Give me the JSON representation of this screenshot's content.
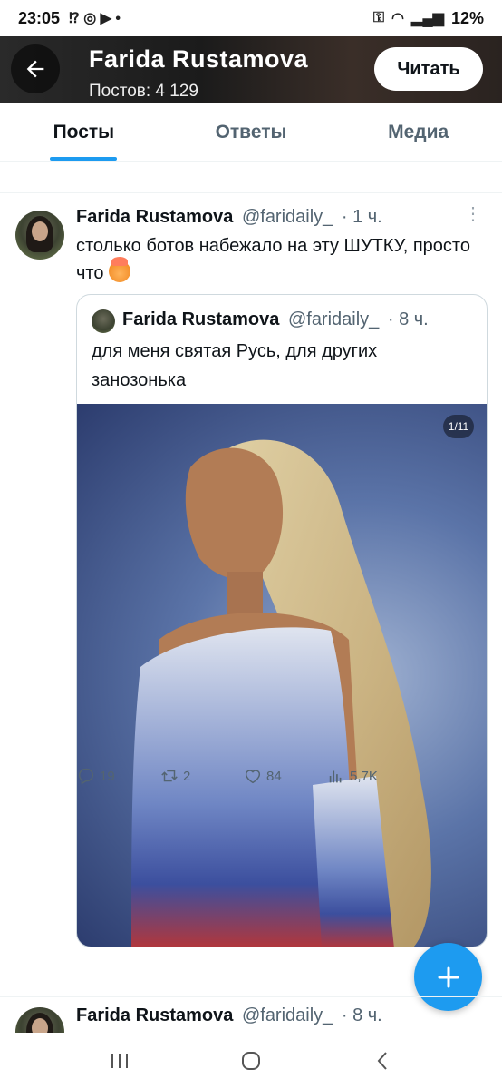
{
  "status_bar": {
    "time": "23:05",
    "battery": "12%"
  },
  "header": {
    "name": "Farida Rustamova",
    "post_count": "Постов: 4 129",
    "read_button": "Читать"
  },
  "tabs": [
    {
      "label": "Посты",
      "active": true
    },
    {
      "label": "Ответы",
      "active": false
    },
    {
      "label": "Медиа",
      "active": false
    }
  ],
  "tweet": {
    "name": "Farida Rustamova",
    "handle": "@faridaily_",
    "time": "· 1 ч.",
    "text": "столько ботов набежало на эту ШУТКУ, просто что",
    "emoji": "exploding-head-emoji",
    "quote": {
      "name": "Farida Rustamova",
      "handle": "@faridaily_",
      "time": "· 8 ч.",
      "text": "для меня святая Русь, для других занозонька",
      "image_counter": "1/11"
    },
    "actions": {
      "replies": "19",
      "retweets": "2",
      "likes": "84",
      "views": "5,7K"
    }
  },
  "next_tweet": {
    "name": "Farida Rustamova",
    "handle": "@faridaily_",
    "time": "· 8 ч."
  },
  "colors": {
    "accent": "#1d9bf0",
    "text": "#0f1419",
    "muted": "#536471"
  }
}
